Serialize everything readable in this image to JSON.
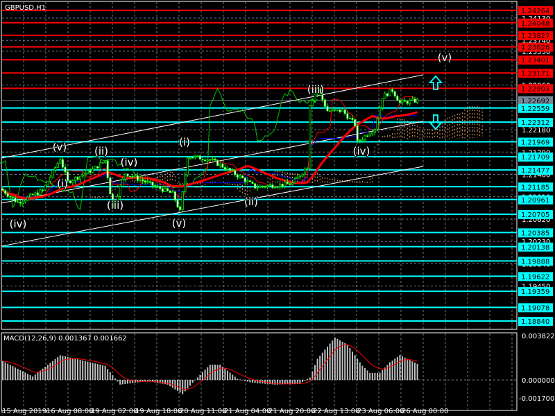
{
  "chart_data": {
    "type": "candlestick",
    "title": "GBPUSD,H1",
    "symbol": "GBPUSD",
    "timeframe": "H1",
    "price_range": [
      1.187,
      1.244
    ],
    "price_grid_labels": [
      "1.24130",
      "1.23740",
      "1.23550",
      "1.22960",
      "1.22180",
      "1.21790",
      "1.21400",
      "1.21010",
      "1.20620",
      "1.20230",
      "1.19840",
      "1.19450"
    ],
    "time_labels": [
      "15 Aug 2019",
      "16 Aug 08:00",
      "19 Aug 02:00",
      "19 Aug 18:00",
      "20 Aug 11:00",
      "21 Aug 04:00",
      "21 Aug 20:00",
      "22 Aug 13:00",
      "23 Aug 06:00",
      "26 Aug 00:00"
    ],
    "bars": 167,
    "close_anchors": [
      [
        0,
        1.2112
      ],
      [
        6,
        1.2091
      ],
      [
        16,
        1.2112
      ],
      [
        23,
        1.2168
      ],
      [
        26,
        1.2127
      ],
      [
        36,
        1.2148
      ],
      [
        41,
        1.2164
      ],
      [
        44,
        1.2081
      ],
      [
        49,
        1.2142
      ],
      [
        68,
        1.2106
      ],
      [
        71,
        1.2075
      ],
      [
        74,
        1.2172
      ],
      [
        83,
        1.2166
      ],
      [
        88,
        1.2154
      ],
      [
        97,
        1.213
      ],
      [
        101,
        1.2118
      ],
      [
        116,
        1.2124
      ],
      [
        122,
        1.2154
      ],
      [
        123,
        1.2263
      ],
      [
        126,
        1.229
      ],
      [
        130,
        1.2251
      ],
      [
        136,
        1.2251
      ],
      [
        141,
        1.2227
      ],
      [
        142,
        1.2196
      ],
      [
        149,
        1.2221
      ],
      [
        152,
        1.2275
      ],
      [
        156,
        1.2287
      ],
      [
        159,
        1.2265
      ],
      [
        166,
        1.2269
      ]
    ],
    "levels": [
      {
        "price": 1.24264,
        "label": "1.24264",
        "color": "#ff0000"
      },
      {
        "price": 1.24048,
        "label": "1.24048",
        "color": "#ff0000"
      },
      {
        "price": 1.23827,
        "label": "1.23827",
        "color": "#ff0000"
      },
      {
        "price": 1.23626,
        "label": "1.23626",
        "color": "#ff0000"
      },
      {
        "price": 1.23401,
        "label": "1.23401",
        "color": "#ff0000"
      },
      {
        "price": 1.23171,
        "label": "1.23171",
        "color": "#ff0000"
      },
      {
        "price": 1.22903,
        "label": "1.22903",
        "color": "#ff0000"
      },
      {
        "price": 1.22692,
        "label": "1.22692",
        "color": "#778899"
      },
      {
        "price": 1.22559,
        "label": "1.22559",
        "color": "#00ffff"
      },
      {
        "price": 1.22312,
        "label": "1.22312",
        "color": "#00ffff"
      },
      {
        "price": 1.21969,
        "label": "1.21969",
        "color": "#00ffff"
      },
      {
        "price": 1.21709,
        "label": "1.21709",
        "color": "#00ffff"
      },
      {
        "price": 1.21477,
        "label": "1.21477",
        "color": "#00ffff"
      },
      {
        "price": 1.21185,
        "label": "1.21185",
        "color": "#00ffff"
      },
      {
        "price": 1.20961,
        "label": "1.20961",
        "color": "#00ffff"
      },
      {
        "price": 1.20705,
        "label": "1.20705",
        "color": "#00ffff"
      },
      {
        "price": 1.20385,
        "label": "1.20385",
        "color": "#00ffff"
      },
      {
        "price": 1.20138,
        "label": "1.20138",
        "color": "#00ffff"
      },
      {
        "price": 1.19888,
        "label": "1.19888",
        "color": "#00ffff"
      },
      {
        "price": 1.19622,
        "label": "1.19622",
        "color": "#00ffff"
      },
      {
        "price": 1.19359,
        "label": "1.19359",
        "color": "#00ffff"
      },
      {
        "price": 1.19078,
        "label": "1.19078",
        "color": "#00ffff"
      },
      {
        "price": 1.1884,
        "label": "1.18840",
        "color": "#00ffff"
      }
    ],
    "wave_labels": [
      "(iv)",
      "(v)",
      "(i)",
      "(ii)",
      "(iii)",
      "(iv)",
      "(v)",
      "(i)",
      "(ii)",
      "(iii)",
      "(iv)",
      "(v)"
    ],
    "macd": {
      "label": "MACD(12,26,9) 0.001367 0.001662",
      "axis_labels": [
        "0.003822",
        "0.000000",
        "-0.001700"
      ],
      "range": [
        -0.0017,
        0.003822
      ],
      "hist_anchors": [
        [
          0,
          0.0016
        ],
        [
          12,
          0.0003
        ],
        [
          23,
          0.0021
        ],
        [
          41,
          0.0012
        ],
        [
          44,
          0.0004
        ],
        [
          47,
          -0.0004
        ],
        [
          58,
          -0.0001
        ],
        [
          66,
          -0.0004
        ],
        [
          72,
          -0.0012
        ],
        [
          77,
          0.0
        ],
        [
          83,
          0.0013
        ],
        [
          87,
          0.0013
        ],
        [
          94,
          0.0001
        ],
        [
          99,
          -0.0002
        ],
        [
          109,
          -0.0004
        ],
        [
          119,
          -0.0003
        ],
        [
          123,
          0.0002
        ],
        [
          126,
          0.0018
        ],
        [
          133,
          0.0036
        ],
        [
          138,
          0.003
        ],
        [
          144,
          0.0012
        ],
        [
          147,
          0.0006
        ],
        [
          151,
          0.0006
        ],
        [
          155,
          0.0015
        ],
        [
          159,
          0.0021
        ],
        [
          166,
          0.001367
        ]
      ]
    }
  },
  "colors": {
    "candle": "#00ff00",
    "bear": "#ffffff",
    "ma": "#ff0000",
    "kijun": "#0000ff",
    "chikou": "#00cc00",
    "cloud": "#f4a460",
    "arrow": "#00ffff"
  }
}
